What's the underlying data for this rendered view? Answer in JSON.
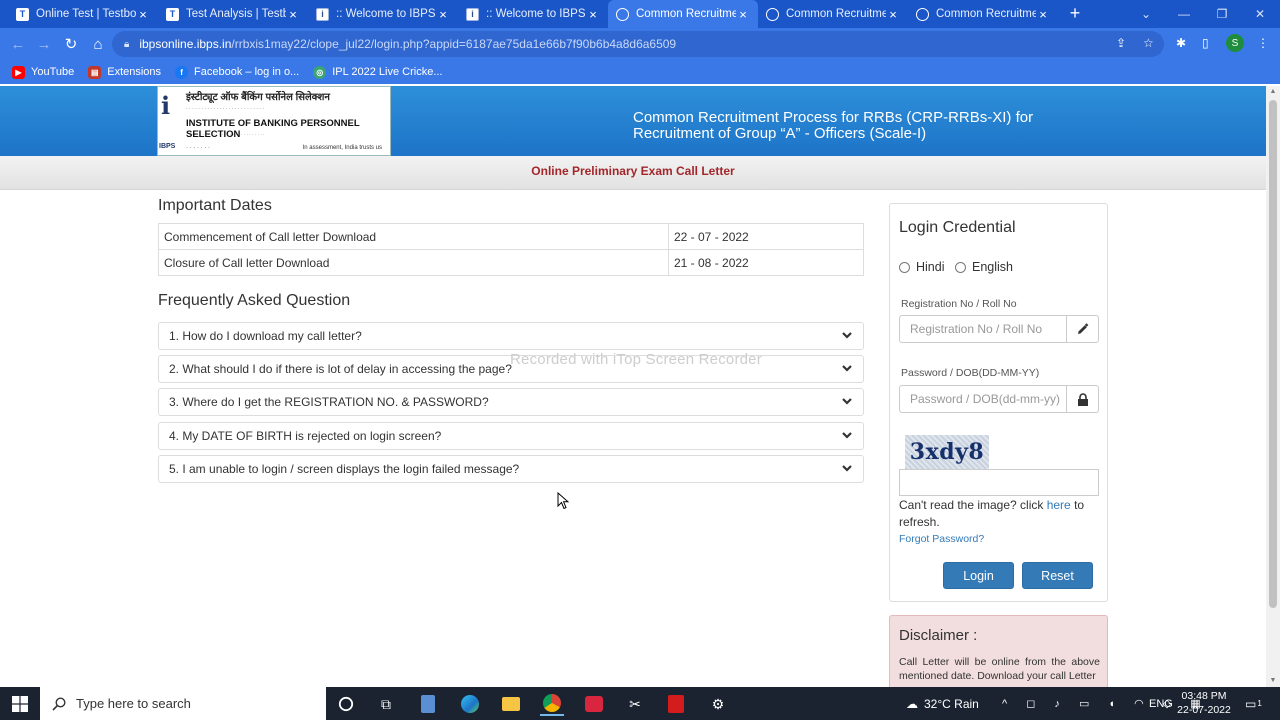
{
  "browser": {
    "tabs": [
      {
        "title": "Online Test | Testbook",
        "icon": "testbook-favicon",
        "active": false
      },
      {
        "title": "Test Analysis | Testbook",
        "icon": "testbook-favicon",
        "active": false
      },
      {
        "title": ":: Welcome to IBPS ::",
        "icon": "ibps-favicon",
        "active": false
      },
      {
        "title": ":: Welcome to IBPS ::",
        "icon": "ibps-favicon",
        "active": false
      },
      {
        "title": "Common Recruitment",
        "icon": "globe-icon",
        "active": true
      },
      {
        "title": "Common Recruitment",
        "icon": "globe-icon",
        "active": false
      },
      {
        "title": "Common Recruitment",
        "icon": "globe-icon",
        "active": false
      }
    ],
    "new_tab": "+",
    "url_host": "ibpsonline.ibps.in",
    "url_path": "/rrbxis1may22/clope_jul22/login.php?appid=6187ae75da1e66b7f90b6b4a8d6a6509",
    "profile_initial": "S",
    "bookmarks": [
      {
        "label": "YouTube",
        "icon": "youtube-icon",
        "color": "#ff0000"
      },
      {
        "label": "Extensions",
        "icon": "extensions-icon",
        "color": "#c0392b"
      },
      {
        "label": "Facebook – log in o...",
        "icon": "facebook-icon",
        "color": "#1877f2"
      },
      {
        "label": "IPL 2022 Live Cricke...",
        "icon": "ipl-icon",
        "color": "#3aa574"
      }
    ]
  },
  "header": {
    "logo_hindi": "इंस्टीट्यूट ऑफ बैंकिंग पर्सोनेल सिलेक्शन",
    "logo_name": "INSTITUTE OF BANKING PERSONNEL SELECTION",
    "logo_mark": "IBPS",
    "logo_motto": "In assessment, India trusts us",
    "title": "Common Recruitment Process for RRBs (CRP-RRBs-XI) for Recruitment of Group “A” - Officers (Scale-I)"
  },
  "subheader": "Online Preliminary Exam Call Letter",
  "important_dates": {
    "heading": "Important Dates",
    "rows": [
      {
        "label": "Commencement of Call letter Download",
        "value": "22 - 07 - 2022"
      },
      {
        "label": "Closure of Call letter Download",
        "value": "21 - 08 - 2022"
      }
    ]
  },
  "faq": {
    "heading": "Frequently Asked Question",
    "items": [
      "1. How do I download my call letter?",
      "2. What should I do if there is lot of delay in accessing the page?",
      "3. Where do I get the REGISTRATION NO. & PASSWORD?",
      "4. My DATE OF BIRTH is rejected on login screen?",
      "5. I am unable to login / screen displays the login failed message?"
    ]
  },
  "watermark": "Recorded with iTop Screen Recorder",
  "login": {
    "title": "Login Credential",
    "lang_options": [
      "Hindi",
      "English"
    ],
    "reg_label": "Registration No / Roll No",
    "reg_placeholder": "Registration No / Roll No",
    "pwd_label": "Password / DOB(DD-MM-YY)",
    "pwd_placeholder": "Password / DOB(dd-mm-yy)",
    "captcha_text": "3xdy8",
    "hint_before": "Can't read the image? click ",
    "hint_link": "here",
    "hint_after": " to refresh.",
    "forgot": "Forgot Password?",
    "login_btn": "Login",
    "reset_btn": "Reset"
  },
  "disclaimer": {
    "title": "Disclaimer :",
    "text": "Call Letter will be online from the above mentioned date. Download your call Letter"
  },
  "taskbar": {
    "search_placeholder": "Type here to search",
    "weather": "32°C Rain",
    "language": "ENG",
    "time": "03:48 PM",
    "date": "22-07-2022",
    "notifications": "1"
  }
}
